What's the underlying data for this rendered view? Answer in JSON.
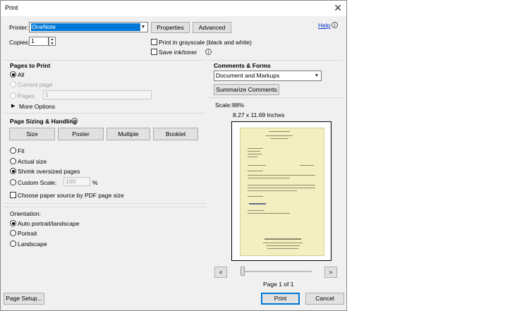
{
  "window": {
    "title": "Print",
    "close_glyph": "✕"
  },
  "printer": {
    "label": "Printer:",
    "selected": "OneNote",
    "properties_label": "Properties",
    "advanced_label": "Advanced",
    "help_label": "Help"
  },
  "copies": {
    "label": "Copies:",
    "value": "1"
  },
  "options": {
    "grayscale_label": "Print in grayscale (black and white)",
    "save_ink_label": "Save ink/toner"
  },
  "pages_to_print": {
    "heading": "Pages to Print",
    "all_label": "All",
    "current_page_label": "Current page",
    "pages_label": "Pages",
    "pages_value": "1",
    "more_options_label": "More Options"
  },
  "sizing": {
    "heading": "Page Sizing & Handling",
    "buttons": [
      "Size",
      "Poster",
      "Multiple",
      "Booklet"
    ],
    "fit_label": "Fit",
    "actual_size_label": "Actual size",
    "shrink_label": "Shrink oversized pages",
    "custom_scale_label": "Custom Scale:",
    "custom_scale_value": "100",
    "percent": "%",
    "paper_source_label": "Choose paper source by PDF page size"
  },
  "orientation": {
    "heading": "Orientation:",
    "auto_label": "Auto portrait/landscape",
    "portrait_label": "Portrait",
    "landscape_label": "Landscape"
  },
  "comments_forms": {
    "heading": "Comments & Forms",
    "selected": "Document and Markups",
    "summarize_label": "Summarize Comments"
  },
  "preview": {
    "scale_label": "Scale:",
    "scale_value": "88%",
    "page_size": "8.27 x 11.69 Inches",
    "prev_glyph": "<",
    "next_glyph": ">",
    "page_indicator": "Page 1 of 1"
  },
  "footer": {
    "page_setup_label": "Page Setup...",
    "print_label": "Print",
    "cancel_label": "Cancel"
  },
  "icons": {
    "help": "info-circle-icon",
    "sizing_info": "info-circle-icon",
    "save_ink_info": "info-circle-icon",
    "more_options": "triangle-right-icon",
    "dropdown": "chevron-down-icon"
  },
  "colors": {
    "selection_blue": "#0078d7",
    "dialog_bg": "#f0f0f0",
    "document_paper": "#f3efc0"
  }
}
